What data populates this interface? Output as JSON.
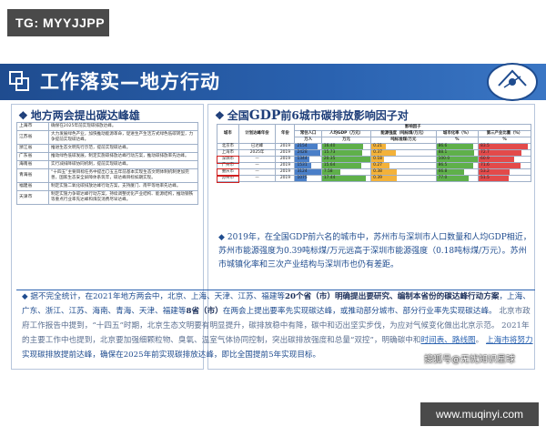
{
  "watermark_top": "TG: MYYJJPP",
  "watermark_bottom": "www.muqinyi.com",
  "sohu_mark": "搜狐号@无忧知识星球",
  "title": "工作落实—地方行动",
  "left": {
    "heading": "地方两会提出碳达峰雄",
    "rows": [
      {
        "region": "上海市",
        "text": "确保在2025年前实现碳排放达峰。"
      },
      {
        "region": "江苏省",
        "text": "大力发展绿色产业，加快推动能源革命，促进生产生活方式绿色低碳转型，力争提前实现碳达峰。"
      },
      {
        "region": "浙江省",
        "text": "推进生态文明先行示范，提前实现碳达峰。"
      },
      {
        "region": "广东省",
        "text": "推动绿色低碳发展，制定实施碳排放达峰行动方案，推动碳排放率先达峰。"
      },
      {
        "region": "海南省",
        "text": "实行减排降碳协同机制，提前实现碳达峰。"
      },
      {
        "region": "青海省",
        "text": "“十四五”主要目标任务中提出〇五五年前基本实现生态文明体制机制更加完善，国家生态安全屏障体系筑牢，碳达峰目标如期实现。"
      },
      {
        "region": "福建省",
        "text": "制定实施二氧化碳排放达峰行动方案，支持厦门、南平等地率先达峰。"
      },
      {
        "region": "天津市",
        "text": "制定实施力争碳达峰行动方案，持续调整优化产业结构、能源结构，推动钢铁等重点行业率先达峰和煤炭消费尽早达峰。"
      }
    ]
  },
  "right": {
    "heading_pre": "全国",
    "heading_gdp": "GDP",
    "heading_post": "前6城市碳排放影响因子对",
    "col_headers": {
      "city": "城市",
      "plan_year": "计划达峰年份",
      "year": "年份",
      "factor_group": "影响因子",
      "pop": "常住人口",
      "pop_unit": "万人",
      "gdp_per": "人均GDP（万元）",
      "gdp_per_unit": "万元",
      "energy": "能源强度（吨标煤/万元）",
      "energy_unit": "吨标准煤/万元",
      "urban": "城市化率（%）",
      "urban_unit": "%",
      "tertiary": "第三产业比重（%）",
      "tertiary_unit": "%"
    },
    "rows": [
      {
        "city": "北京市",
        "plan": "已达峰",
        "year": "2019",
        "pop": "2154",
        "gdp": "16.40",
        "energy": "0.21",
        "urban": "86.6",
        "tertiary": "83.5",
        "pop_frac": 0.87,
        "gdp_frac": 0.85,
        "energy_frac": 0.22,
        "urban_frac": 0.9,
        "tertiary_frac": 0.94,
        "hl": false
      },
      {
        "city": "上海市",
        "plan": "2025年",
        "year": "2019",
        "pop": "2428",
        "gdp": "15.73",
        "energy": "0.37",
        "urban": "88.1",
        "tertiary": "72.7",
        "pop_frac": 0.98,
        "gdp_frac": 0.82,
        "energy_frac": 0.38,
        "urban_frac": 0.92,
        "tertiary_frac": 0.82,
        "hl": false
      },
      {
        "city": "深圳市",
        "plan": "—",
        "year": "2019",
        "pop": "1344",
        "gdp": "20.35",
        "energy": "0.18",
        "urban": "100.0",
        "tertiary": "60.9",
        "pop_frac": 0.54,
        "gdp_frac": 1.0,
        "energy_frac": 0.19,
        "urban_frac": 1.0,
        "tertiary_frac": 0.69,
        "hl": true
      },
      {
        "city": "广州市",
        "plan": "—",
        "year": "2019",
        "pop": "1531",
        "gdp": "15.64",
        "energy": "0.27",
        "urban": "86.5",
        "tertiary": "71.6",
        "pop_frac": 0.62,
        "gdp_frac": 0.81,
        "energy_frac": 0.28,
        "urban_frac": 0.89,
        "tertiary_frac": 0.81,
        "hl": false
      },
      {
        "city": "重庆市",
        "plan": "—",
        "year": "2019",
        "pop": "3124",
        "gdp": "7.58",
        "energy": "0.38",
        "urban": "66.8",
        "tertiary": "53.2",
        "pop_frac": 1.0,
        "gdp_frac": 0.38,
        "energy_frac": 0.39,
        "urban_frac": 0.68,
        "tertiary_frac": 0.6,
        "hl": true
      },
      {
        "city": "苏州市",
        "plan": "—",
        "year": "2019",
        "pop": "1075",
        "gdp": "17.44",
        "energy": "0.39",
        "urban": "77.0",
        "tertiary": "51.5",
        "pop_frac": 0.44,
        "gdp_frac": 0.91,
        "energy_frac": 0.4,
        "urban_frac": 0.79,
        "tertiary_frac": 0.58,
        "hl": true
      }
    ],
    "analysis": "2019年，在全国GDP前六名的城市中，苏州市与深圳市人口数量和人均GDP相近，苏州市能源强度为0.39吨标煤/万元远高于深圳市能源强度（0.18吨标煤/万元）。苏州市城镇化率和三次产业结构与深圳市也仍有差距。"
  },
  "bottom": {
    "p1_a": "据不完全统计，在2021年地方两会中，北京、上海、天津、江苏、福建等",
    "p1_b": "20个省（市）明确提出要研究、编制本省份的碳达峰行动方案",
    "p1_c": "，上海、广东、浙江、江苏、海南、青海、天津、福建等",
    "p1_d": "8省（市）",
    "p1_e": "在两会上提出要率先实现碳达峰，或推动部分城市、部分行业率先实现碳达峰。",
    "p2": "北京市政府工作报告中提到，“十四五”时期，北京生态文明要有明显提升，碳排放稳中有降，碳中和迈出坚实步伐，为应对气候变化做出北京示范。",
    "p3_a": "2021年的主要工作中也提到，北京要加强细颗粒物、臭氧、温室气体协同控制，突出碳排放强度和总量“双控”，明确碳中和",
    "p3_link": "时间表、路线图",
    "p3_b": "。",
    "p3_c": "上海市将努力",
    "p3_d": "实现碳排放提前达峰，确保在2025年前实现碳排放达峰，即比全国提前5年实现目标。"
  },
  "colors": {
    "title_bar": "#1f4c8f",
    "accent": "#1f4c8f",
    "pop_bar": "#4a7fc8",
    "gdp_bar": "#5fb04a",
    "energy_bar": "#f3b23a",
    "urban_bar": "#5fb04a",
    "tertiary_bar": "#e34a4a"
  }
}
